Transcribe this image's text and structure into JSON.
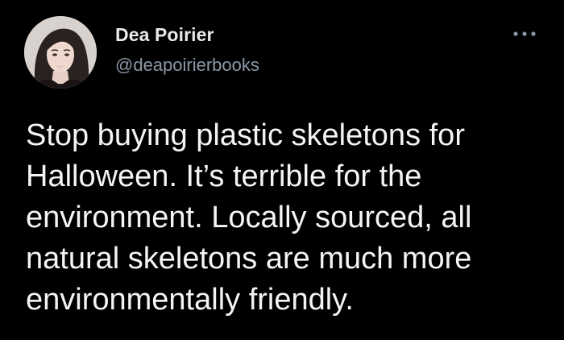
{
  "author": {
    "display_name": "Dea Poirier",
    "handle": "@deapoirierbooks",
    "avatar_icon": "profile-photo"
  },
  "tweet": {
    "text": "Stop buying plastic skeletons for\nHalloween. It’s terrible for the\nenvironment. Locally sourced, all\nnatural skeletons are much more\nenvironmentally friendly."
  },
  "menu": {
    "icon": "more-options-icon"
  },
  "colors": {
    "background": "#000000",
    "name": "#e7e9ea",
    "handle": "#8b98a5",
    "text": "#f2f4f5"
  }
}
